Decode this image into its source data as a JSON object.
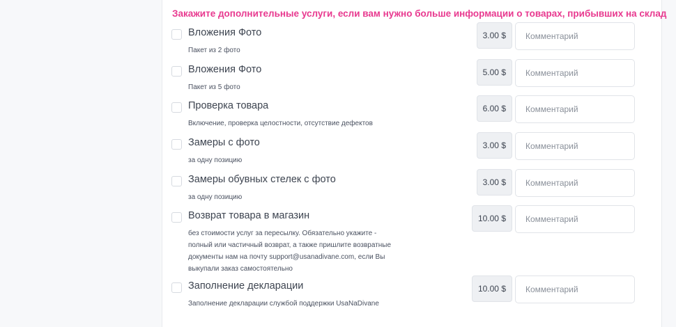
{
  "section": {
    "heading": "Закажите дополнительные услуги, если вам нужно больше информации о товарах, прибывших на склад",
    "accent_color": "#e8398f"
  },
  "services": [
    {
      "title": "Вложения Фото",
      "description": "Пакет из 2 фото",
      "price": "3.00 $",
      "comment_placeholder": "Комментарий",
      "checked": false
    },
    {
      "title": "Вложения Фото",
      "description": "Пакет из 5 фото",
      "price": "5.00 $",
      "comment_placeholder": "Комментарий",
      "checked": false
    },
    {
      "title": "Проверка товара",
      "description": "Включение, проверка целостности, отсутствие дефектов",
      "price": "6.00 $",
      "comment_placeholder": "Комментарий",
      "checked": false
    },
    {
      "title": "Замеры с фото",
      "description": "за одну позицию",
      "price": "3.00 $",
      "comment_placeholder": "Комментарий",
      "checked": false
    },
    {
      "title": "Замеры обувных стелек с фото",
      "description": "за одну позицию",
      "price": "3.00 $",
      "comment_placeholder": "Комментарий",
      "checked": false
    },
    {
      "title": "Возврат товара в магазин",
      "description": "без стоимости услуг за пересылку. Обязательно укажите - полный или частичный возврат, а также пришлите возвратные документы нам на почту support@usanadivane.com, если Вы выкупали заказ самостоятельно",
      "price": "10.00 $",
      "comment_placeholder": "Комментарий",
      "checked": false
    },
    {
      "title": "Заполнение декларации",
      "description": "Заполнение декларации службой поддержки UsaNaDivane",
      "price": "10.00 $",
      "comment_placeholder": "Комментарий",
      "checked": false
    }
  ]
}
